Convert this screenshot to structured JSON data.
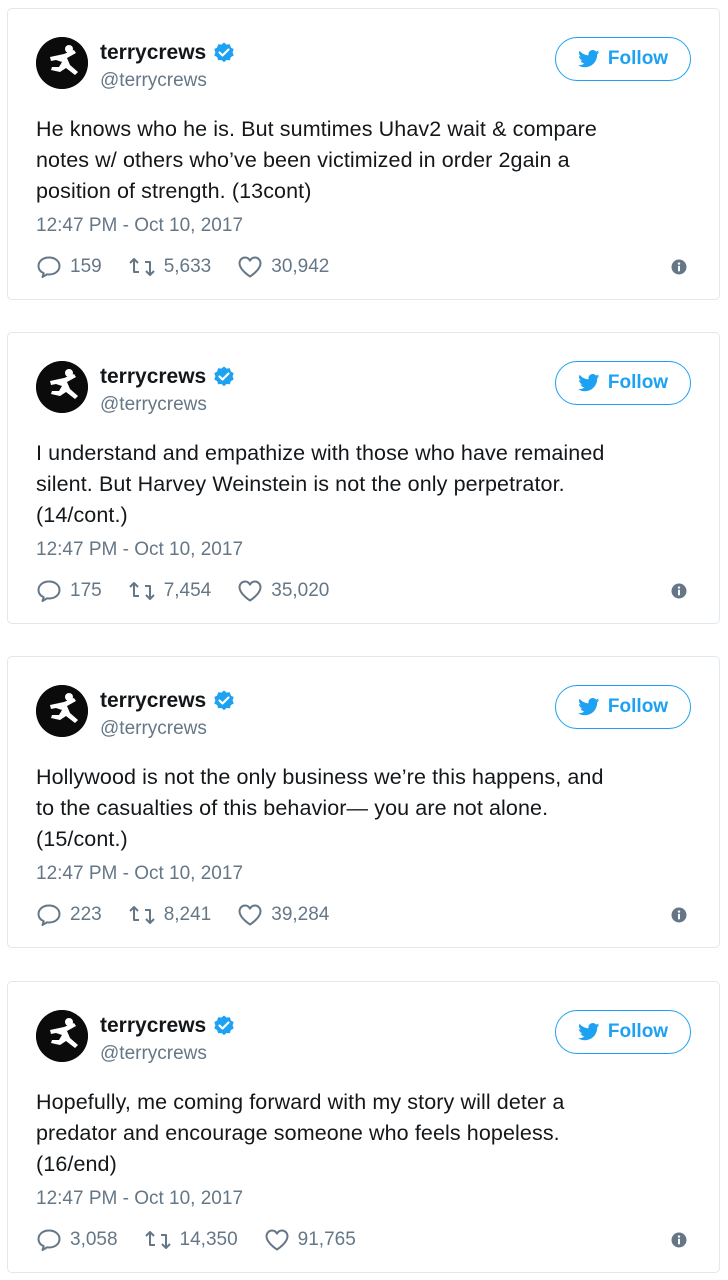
{
  "tweets": [
    {
      "display_name": "terrycrews",
      "handle": "@terrycrews",
      "follow_label": "Follow",
      "text": "He knows who he is. But sumtimes Uhav2 wait & compare\nnotes w/ others who’ve been victimized in order 2gain a\nposition of strength. (13cont)",
      "timestamp": "12:47 PM - Oct 10, 2017",
      "replies": "159",
      "retweets": "5,633",
      "likes": "30,942"
    },
    {
      "display_name": "terrycrews",
      "handle": "@terrycrews",
      "follow_label": "Follow",
      "text": "I understand and empathize with those who have remained\nsilent. But Harvey Weinstein is not the only perpetrator.\n(14/cont.)",
      "timestamp": "12:47 PM - Oct 10, 2017",
      "replies": "175",
      "retweets": "7,454",
      "likes": "35,020"
    },
    {
      "display_name": "terrycrews",
      "handle": "@terrycrews",
      "follow_label": "Follow",
      "text": "Hollywood is not the only business we’re this happens, and\nto the casualties of this behavior— you are not alone.\n(15/cont.)",
      "timestamp": "12:47 PM - Oct 10, 2017",
      "replies": "223",
      "retweets": "8,241",
      "likes": "39,284"
    },
    {
      "display_name": "terrycrews",
      "handle": "@terrycrews",
      "follow_label": "Follow",
      "text": "Hopefully, me coming forward with my story will deter a\npredator and encourage someone who feels hopeless.\n(16/end)",
      "timestamp": "12:47 PM - Oct 10, 2017",
      "replies": "3,058",
      "retweets": "14,350",
      "likes": "91,765"
    }
  ],
  "colors": {
    "accent": "#1da1f2",
    "text": "#14171a",
    "secondary": "#657786",
    "border": "#e1e8ed"
  },
  "icons": {
    "avatar": "running-figure-avatar",
    "verified": "verified-badge-icon",
    "follow": "twitter-bird-icon",
    "reply": "reply-icon",
    "retweet": "retweet-icon",
    "like": "heart-icon",
    "info": "info-icon"
  }
}
